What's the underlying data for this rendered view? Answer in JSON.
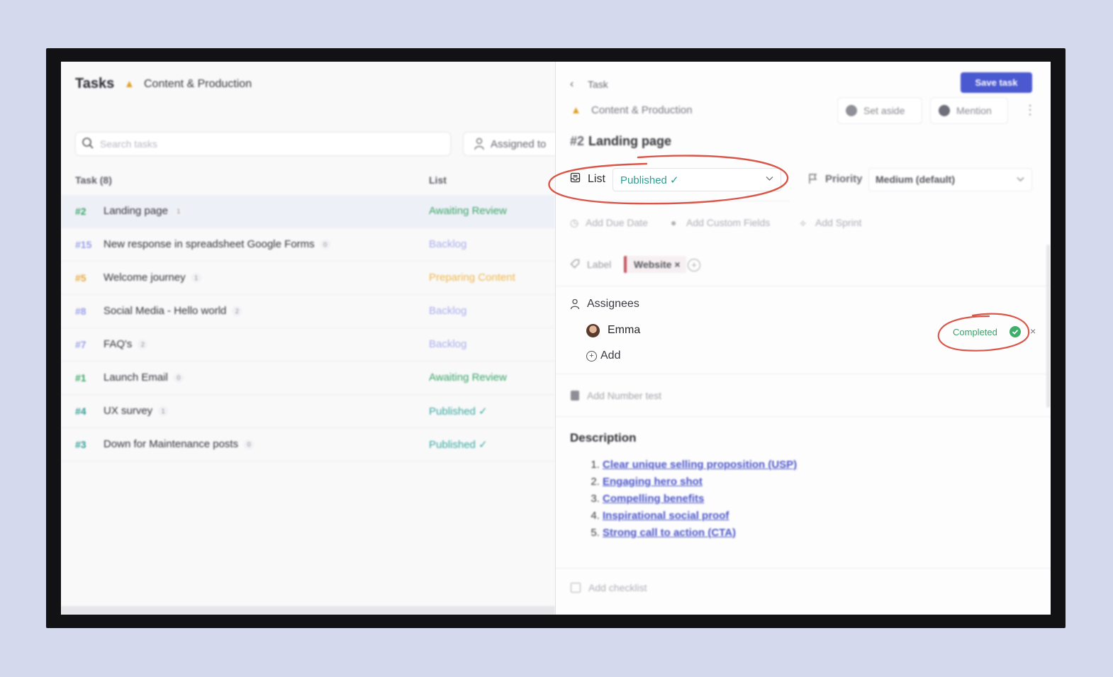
{
  "left_pane": {
    "title": "Tasks",
    "project_icon": "warning-triangle-icon",
    "project_name": "Content & Production",
    "search_placeholder": "Search tasks",
    "assigned_filter": "Assigned to",
    "col_task": "Task (8)",
    "col_list": "List",
    "rows": [
      {
        "num": "#2",
        "name": "Landing page",
        "count": "1",
        "list": "Awaiting Review",
        "num_color": "#3aa566",
        "list_color": "#3aa566"
      },
      {
        "num": "#15",
        "name": "New response in spreadsheet Google Forms",
        "count": "0",
        "list": "Backlog",
        "num_color": "#9aa0e6",
        "list_color": "#a9aeea"
      },
      {
        "num": "#5",
        "name": "Welcome journey",
        "count": "1",
        "list": "Preparing Content",
        "num_color": "#e8a93a",
        "list_color": "#f0b84a"
      },
      {
        "num": "#8",
        "name": "Social Media - Hello world",
        "count": "2",
        "list": "Backlog",
        "num_color": "#9aa0e6",
        "list_color": "#a9aeea"
      },
      {
        "num": "#7",
        "name": "FAQ's",
        "count": "2",
        "list": "Backlog",
        "num_color": "#9aa0e6",
        "list_color": "#a9aeea"
      },
      {
        "num": "#1",
        "name": "Launch Email",
        "count": "0",
        "list": "Awaiting Review",
        "num_color": "#3aa566",
        "list_color": "#3aa566"
      },
      {
        "num": "#4",
        "name": "UX survey",
        "count": "1",
        "list": "Published ✓",
        "num_color": "#2f9b92",
        "list_color": "#3aa9a0"
      },
      {
        "num": "#3",
        "name": "Down for Maintenance posts",
        "count": "0",
        "list": "Published ✓",
        "num_color": "#2f9b92",
        "list_color": "#3aa9a0"
      }
    ]
  },
  "detail": {
    "back_label": "Task",
    "save_button": "Save task",
    "project_name": "Content & Production",
    "set_aside": "Set aside",
    "mention": "Mention",
    "more": "⋮",
    "task_number": "#2",
    "task_title": "Landing page",
    "list_label": "List",
    "list_value": "Published  ✓",
    "priority_label": "Priority",
    "priority_value": "Medium (default)",
    "add_due_date": "Add Due Date",
    "add_custom_fields": "Add Custom Fields",
    "add_sprint": "Add Sprint",
    "label_label": "Label",
    "label_tag": "Website ×",
    "assignees_label": "Assignees",
    "assignee_name": "Emma",
    "assignee_status": "Completed",
    "assignee_remove": "×",
    "add_assignee": "Add",
    "add_number_field": "Add Number test",
    "description_title": "Description",
    "description_items": [
      "Clear unique selling proposition (USP)",
      "Engaging hero shot",
      "Compelling benefits",
      "Inspirational social proof",
      "Strong call to action (CTA)"
    ],
    "add_checklist": "Add checklist"
  },
  "colors": {
    "accent": "#4b59d1",
    "published": "#2d9f93",
    "completed": "#3e9f6a",
    "annotation": "#d9574a",
    "background": "#d5d9ee"
  }
}
